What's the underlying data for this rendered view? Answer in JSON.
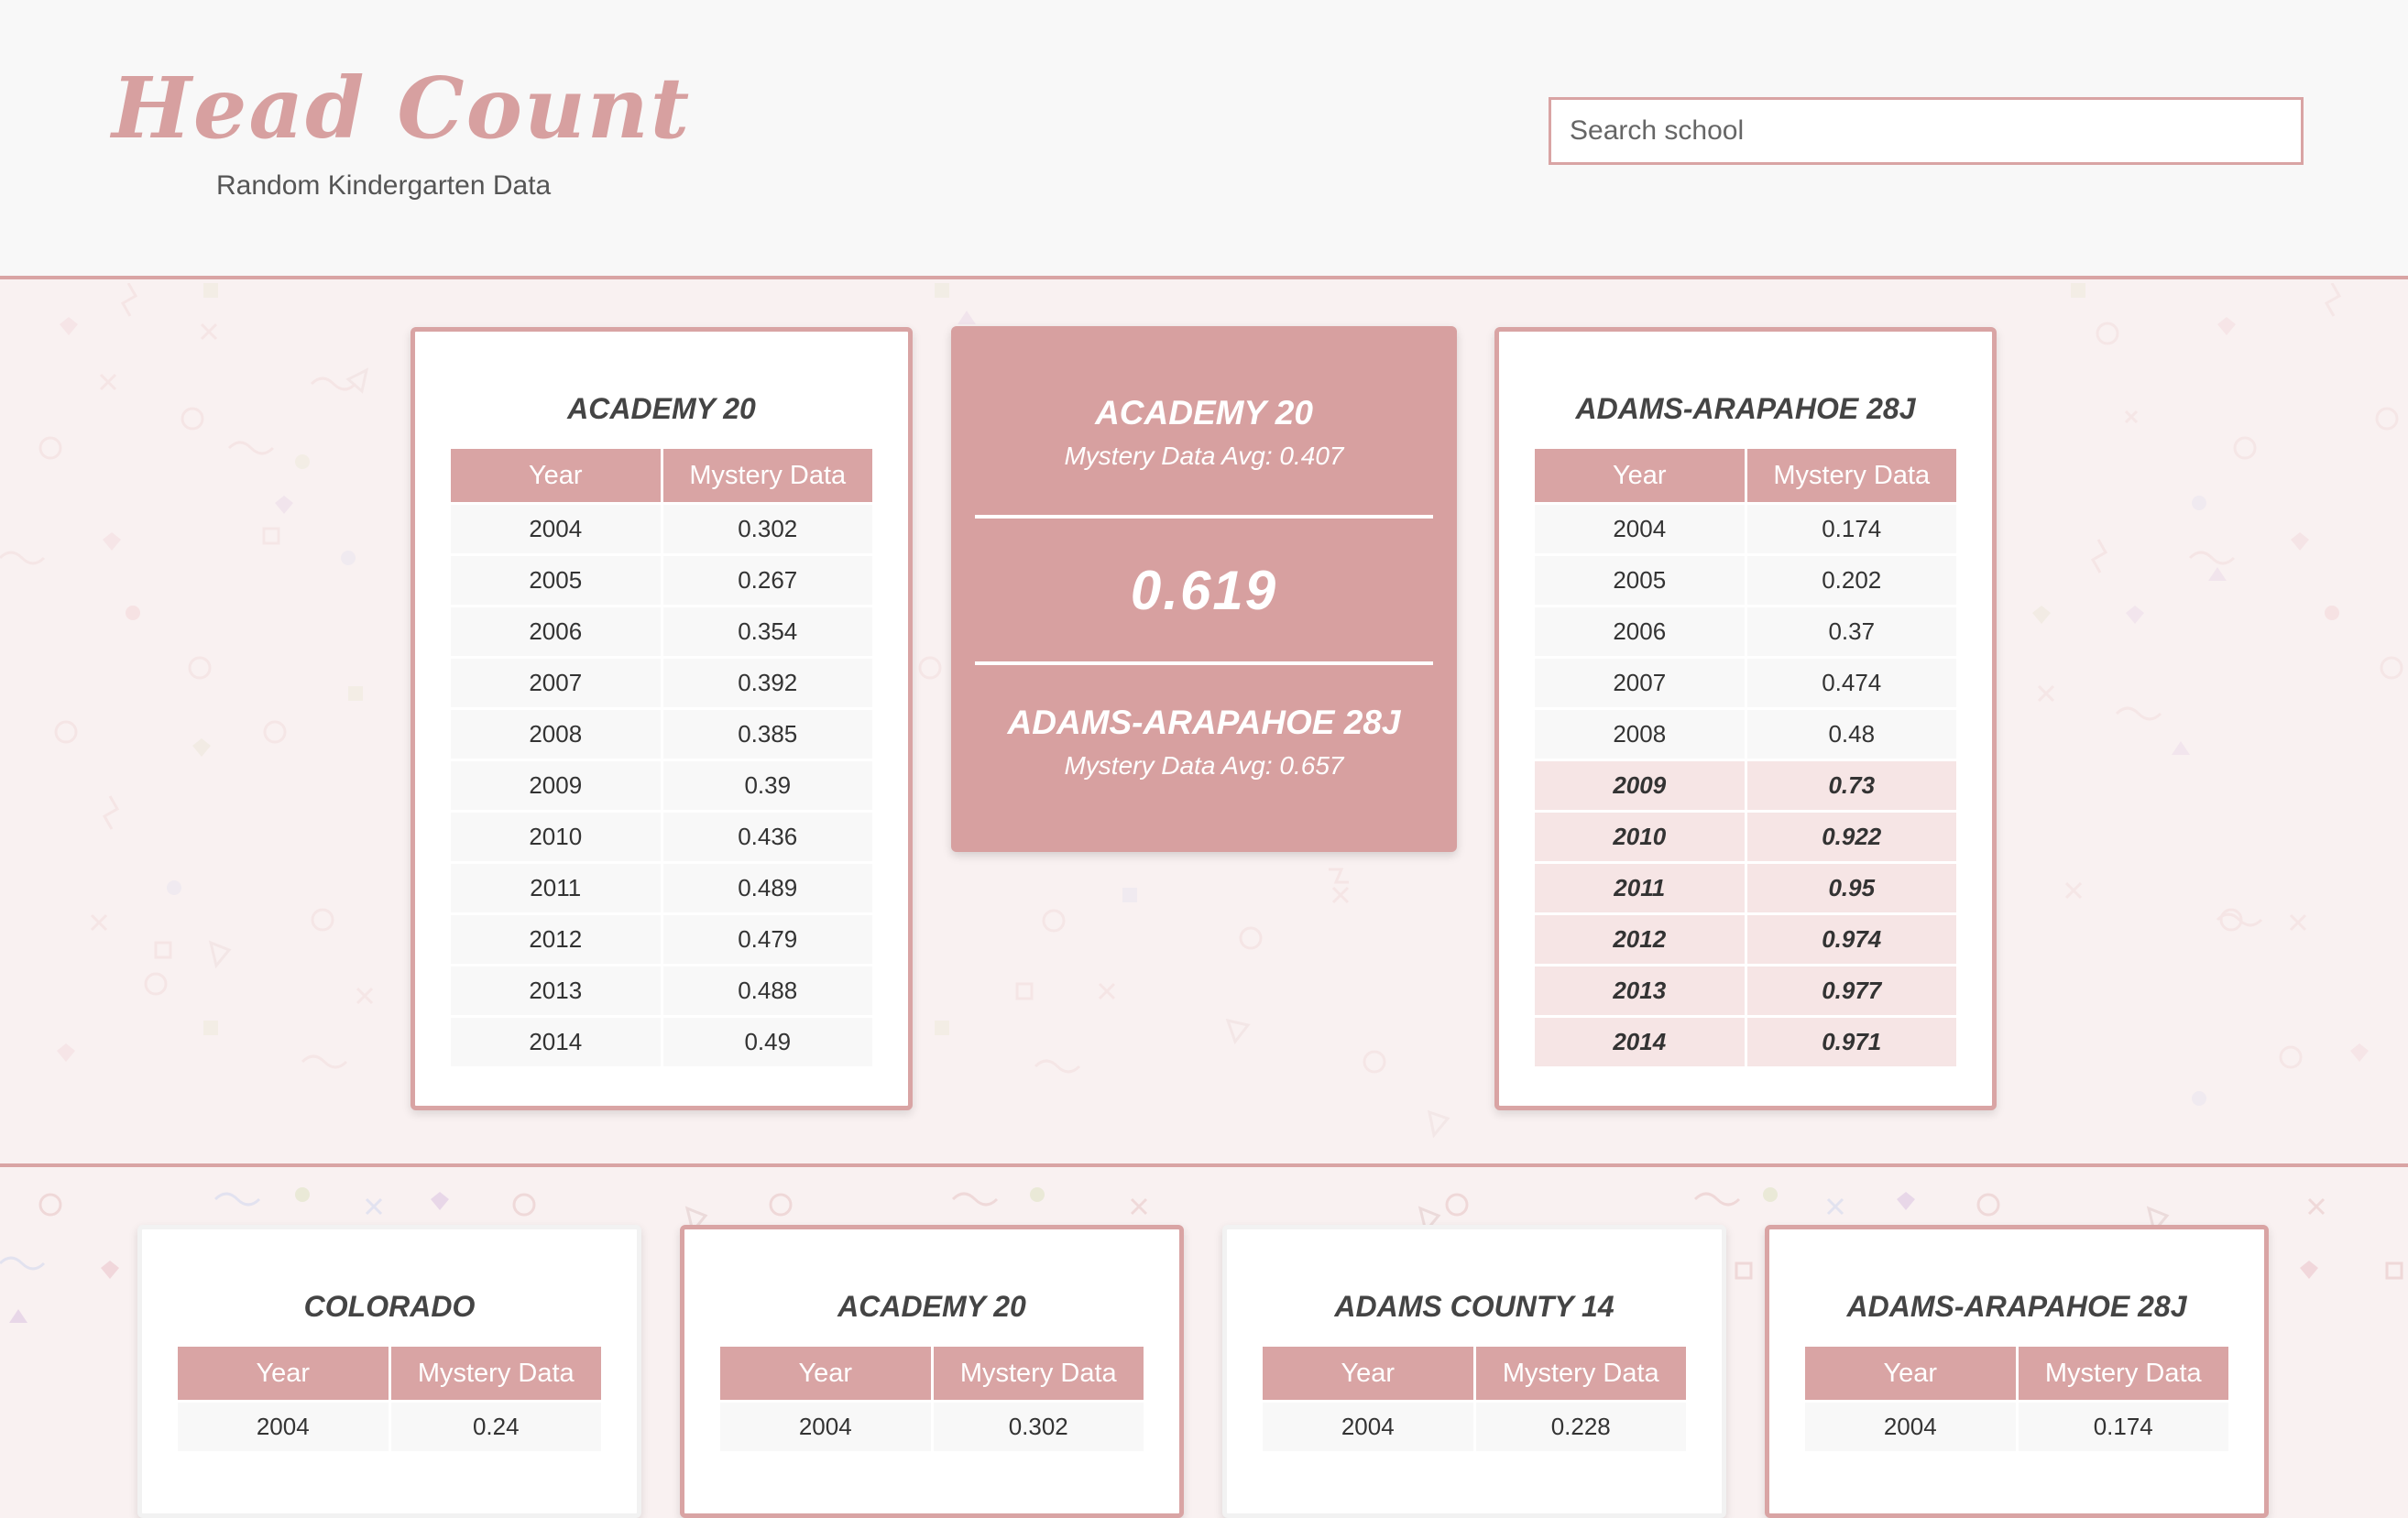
{
  "header": {
    "logo": "Head Count",
    "tagline": "Random Kindergarten Data",
    "search_placeholder": "Search school"
  },
  "compare": {
    "left": {
      "name": "ACADEMY 20",
      "columns": [
        "Year",
        "Mystery Data"
      ],
      "rows": [
        {
          "year": "2004",
          "value": "0.302"
        },
        {
          "year": "2005",
          "value": "0.267"
        },
        {
          "year": "2006",
          "value": "0.354"
        },
        {
          "year": "2007",
          "value": "0.392"
        },
        {
          "year": "2008",
          "value": "0.385"
        },
        {
          "year": "2009",
          "value": "0.39"
        },
        {
          "year": "2010",
          "value": "0.436"
        },
        {
          "year": "2011",
          "value": "0.489"
        },
        {
          "year": "2012",
          "value": "0.479"
        },
        {
          "year": "2013",
          "value": "0.488"
        },
        {
          "year": "2014",
          "value": "0.49"
        }
      ]
    },
    "panel": {
      "top_name": "ACADEMY 20",
      "top_avg": "Mystery Data Avg: 0.407",
      "ratio": "0.619",
      "bottom_name": "ADAMS-ARAPAHOE 28J",
      "bottom_avg": "Mystery Data Avg: 0.657"
    },
    "right": {
      "name": "ADAMS-ARAPAHOE 28J",
      "columns": [
        "Year",
        "Mystery Data"
      ],
      "rows": [
        {
          "year": "2004",
          "value": "0.174"
        },
        {
          "year": "2005",
          "value": "0.202"
        },
        {
          "year": "2006",
          "value": "0.37"
        },
        {
          "year": "2007",
          "value": "0.474"
        },
        {
          "year": "2008",
          "value": "0.48"
        },
        {
          "year": "2009",
          "value": "0.73"
        },
        {
          "year": "2010",
          "value": "0.922"
        },
        {
          "year": "2011",
          "value": "0.95"
        },
        {
          "year": "2012",
          "value": "0.974"
        },
        {
          "year": "2013",
          "value": "0.977"
        },
        {
          "year": "2014",
          "value": "0.971"
        }
      ]
    }
  },
  "grid": [
    {
      "name": "COLORADO",
      "columns": [
        "Year",
        "Mystery Data"
      ],
      "first_row": {
        "year": "2004",
        "value": "0.24"
      }
    },
    {
      "name": "ACADEMY 20",
      "columns": [
        "Year",
        "Mystery Data"
      ],
      "first_row": {
        "year": "2004",
        "value": "0.302"
      }
    },
    {
      "name": "ADAMS COUNTY 14",
      "columns": [
        "Year",
        "Mystery Data"
      ],
      "first_row": {
        "year": "2004",
        "value": "0.228"
      }
    },
    {
      "name": "ADAMS-ARAPAHOE 28J",
      "columns": [
        "Year",
        "Mystery Data"
      ],
      "first_row": {
        "year": "2004",
        "value": "0.174"
      }
    }
  ],
  "colors": {
    "accent": "#d9a4a4",
    "panel": "#d7a0a0",
    "highlight_row": "#f6e5e5"
  }
}
